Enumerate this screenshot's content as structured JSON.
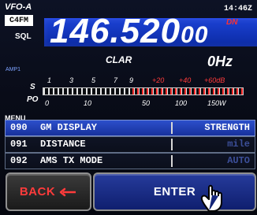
{
  "header": {
    "vfo_label": "VFO-A",
    "mode_badge": "C4FM",
    "sql_label": "SQL",
    "clock": "14:46",
    "clock_suffix": "Z",
    "dn_indicator": "DN",
    "frequency_main": "146.520",
    "frequency_small": "00",
    "clar_label": "CLAR",
    "clar_value": "0Hz",
    "amp_label": "AMP1"
  },
  "meter": {
    "s_label": "S",
    "po_label": "PO",
    "s_scale": [
      "1",
      "3",
      "5",
      "7",
      "9",
      "+20",
      "+40",
      "+60dB"
    ],
    "po_scale": [
      "0",
      "10",
      "50",
      "100",
      "150W"
    ]
  },
  "menu": {
    "title": "MENU",
    "rows": [
      {
        "num": "090",
        "name": "GM DISPLAY",
        "value": "STRENGTH",
        "selected": true
      },
      {
        "num": "091",
        "name": "DISTANCE",
        "value": "mile",
        "selected": false
      },
      {
        "num": "092",
        "name": "AMS TX MODE",
        "value": "AUTO",
        "selected": false
      }
    ]
  },
  "buttons": {
    "back_label": "BACK",
    "enter_label": "ENTER"
  },
  "colors": {
    "blue_freq_bg": "#1b41d3",
    "selected_row": "#2c4fcb",
    "enter_button": "#263b9c",
    "red_accent": "#ff3b3b"
  },
  "icons": {
    "back_arrow": "back-arrow-icon",
    "hand_cursor": "hand-pointer-icon"
  }
}
